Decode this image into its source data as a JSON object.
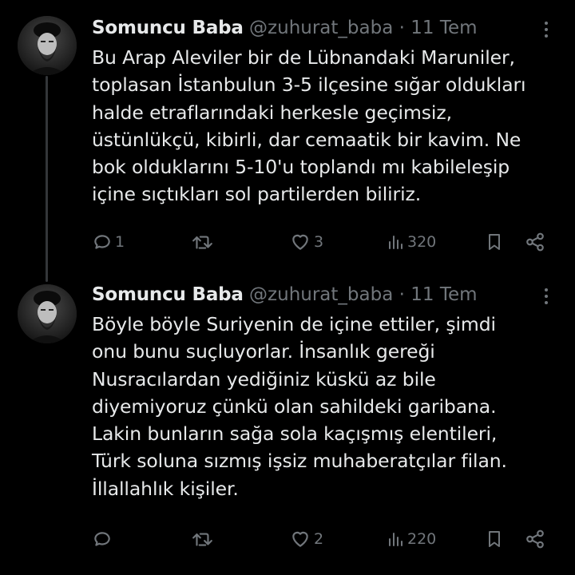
{
  "tweets": [
    {
      "author": "Somuncu Baba",
      "handle": "@zuhurat_baba",
      "separator": "·",
      "date": "11 Tem",
      "text": "Bu Arap Aleviler bir de Lübnandaki Maruniler,\ntoplasan İstanbulun 3-5 ilçesine sığar oldukları\nhalde etraflarındaki herkesle geçimsiz,\nüstünlükçü, kibirli, dar cemaatik bir kavim. Ne\nbok olduklarını 5-10'u toplandı mı kabileleşip\niçine sıçtıkları sol partilerden biliriz.",
      "replies": "1",
      "retweets": "",
      "likes": "3",
      "views": "320"
    },
    {
      "author": "Somuncu Baba",
      "handle": "@zuhurat_baba",
      "separator": "·",
      "date": "11 Tem",
      "text": "Böyle böyle Suriyenin de içine ettiler, şimdi\nonu bunu suçluyorlar. İnsanlık gereği\nNusracılardan yediğiniz küskü az bile\ndiyemiyoruz çünkü olan sahildeki garibana.\nLakin bunların sağa sola kaçışmış elentileri,\nTürk soluna sızmış işsiz muhaberatçılar filan.\nİllallahlık kişiler.",
      "replies": "",
      "retweets": "",
      "likes": "2",
      "views": "220"
    }
  ],
  "colors": {
    "background": "#000000",
    "text": "#e7e9ea",
    "muted": "#71767b",
    "thread_line": "#333639"
  },
  "icons": [
    "more-icon",
    "reply-icon",
    "retweet-icon",
    "like-icon",
    "views-icon",
    "bookmark-icon",
    "share-icon"
  ]
}
